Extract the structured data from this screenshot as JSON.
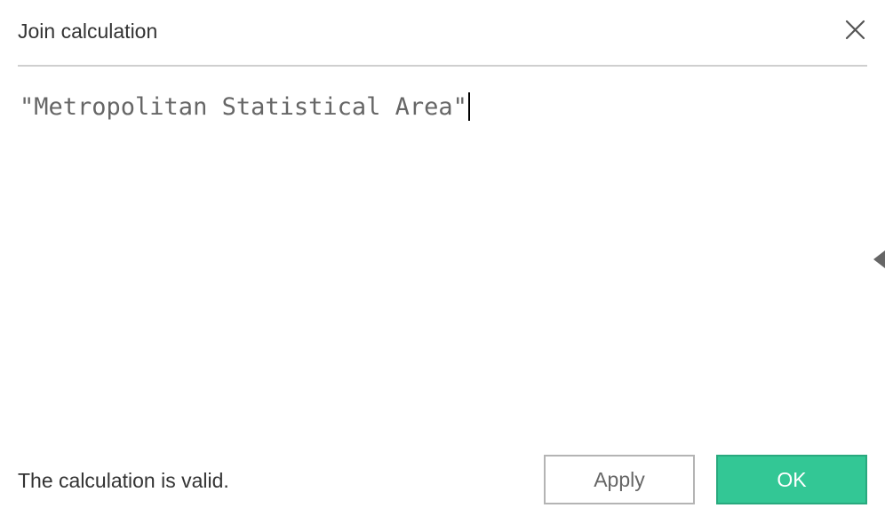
{
  "dialog": {
    "title": "Join calculation",
    "close_icon": "close-icon"
  },
  "editor": {
    "formula": "\"Metropolitan Statistical Area\""
  },
  "side_panel": {
    "toggle_icon": "triangle-left-icon"
  },
  "footer": {
    "status": "The calculation is valid.",
    "apply_label": "Apply",
    "ok_label": "OK"
  },
  "colors": {
    "ok_background": "#33c795",
    "ok_border": "#29a97e",
    "divider": "#cfcfcf",
    "apply_border": "#b4b4b4"
  }
}
